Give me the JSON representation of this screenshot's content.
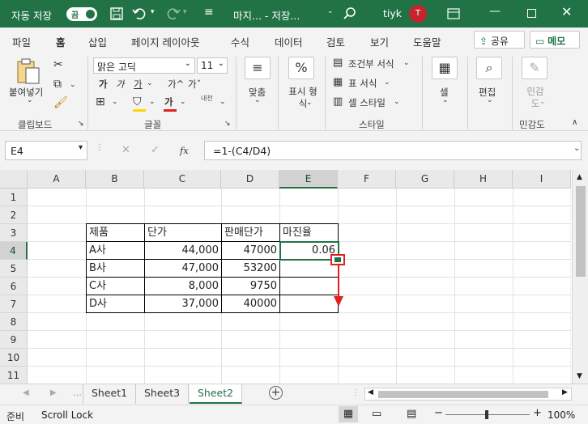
{
  "titlebar": {
    "autosave_label": "자동 저장",
    "autosave_state": "끔",
    "doc_title": "마지... - 저장...",
    "user": "tiyk",
    "avatar_initial": "T"
  },
  "menu": {
    "tabs": [
      "파일",
      "홈",
      "삽입",
      "페이지 레이아웃",
      "수식",
      "데이터",
      "검토",
      "보기",
      "도움말"
    ],
    "active": "홈",
    "share": "공유",
    "memo": "메모"
  },
  "ribbon": {
    "paste": "붙여넣기",
    "clipboard": "클립보드",
    "font_name": "맑은 고딕",
    "font_size": "11",
    "font_group": "글꼴",
    "align": "맞춤",
    "number": "표시 형식",
    "cond_format": "조건부 서식",
    "table_format": "표 서식",
    "cell_style": "셀 스타일",
    "style_group": "스타일",
    "cells": "셀",
    "edit": "편집",
    "sensitivity": "민감도",
    "sensitivity_group": "민감도",
    "font_buttons": [
      "가",
      "가",
      "가",
      "가^",
      "가ˇ"
    ],
    "font_color_label": "가",
    "phonetic": "내천"
  },
  "formula": {
    "name_box": "E4",
    "formula": "=1-(C4/D4)",
    "fx": "fx"
  },
  "sheet": {
    "columns": [
      "A",
      "B",
      "C",
      "D",
      "E",
      "F",
      "G",
      "H",
      "I"
    ],
    "rows": [
      "1",
      "2",
      "3",
      "4",
      "5",
      "6",
      "7",
      "8",
      "9",
      "10",
      "11"
    ],
    "table_header": [
      "제품",
      "단가",
      "판매단가",
      "마진율"
    ],
    "table_rows": [
      [
        "A사",
        "44,000",
        "47000",
        "0.06"
      ],
      [
        "B사",
        "47,000",
        "53200",
        ""
      ],
      [
        "C사",
        "8,000",
        "9750",
        ""
      ],
      [
        "D사",
        "37,000",
        "40000",
        ""
      ]
    ]
  },
  "tabs": [
    "Sheet1",
    "Sheet3",
    "Sheet2"
  ],
  "active_tab": "Sheet2",
  "status": {
    "ready": "준비",
    "scroll_lock": "Scroll Lock",
    "zoom": "100%"
  },
  "colors": {
    "accent": "#217346",
    "arrow": "#e02020"
  }
}
